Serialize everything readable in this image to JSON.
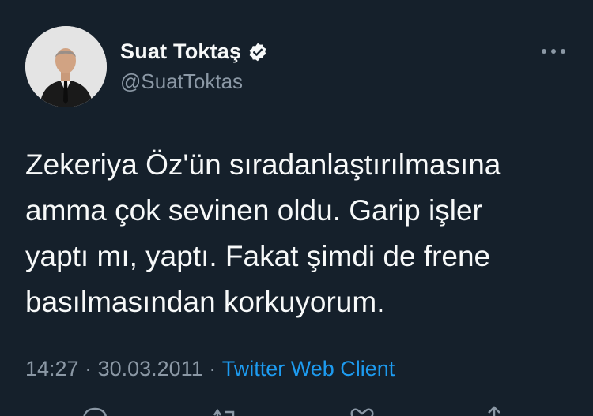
{
  "author": {
    "display_name": "Suat Toktaş",
    "handle": "@SuatToktas",
    "verified": true
  },
  "tweet": {
    "text": "Zekeriya Öz'ün sıradanlaştırılmasına\namma çok sevinen oldu. Garip işler\nyaptı mı, yaptı. Fakat şimdi de frene\nbasılmasından korkuyorum."
  },
  "meta": {
    "time": "14:27",
    "separator1": " · ",
    "date": "30.03.2011",
    "separator2": " · ",
    "client": "Twitter Web Client"
  },
  "icons": {
    "more": "more-horizontal-icon",
    "verified": "verified-badge-icon",
    "reply": "reply-icon",
    "retweet": "retweet-icon",
    "like": "like-icon",
    "share": "share-icon"
  },
  "colors": {
    "background": "#15202b",
    "text": "#f7f9f9",
    "secondary": "#8b98a5",
    "accent": "#1d9bf0"
  }
}
